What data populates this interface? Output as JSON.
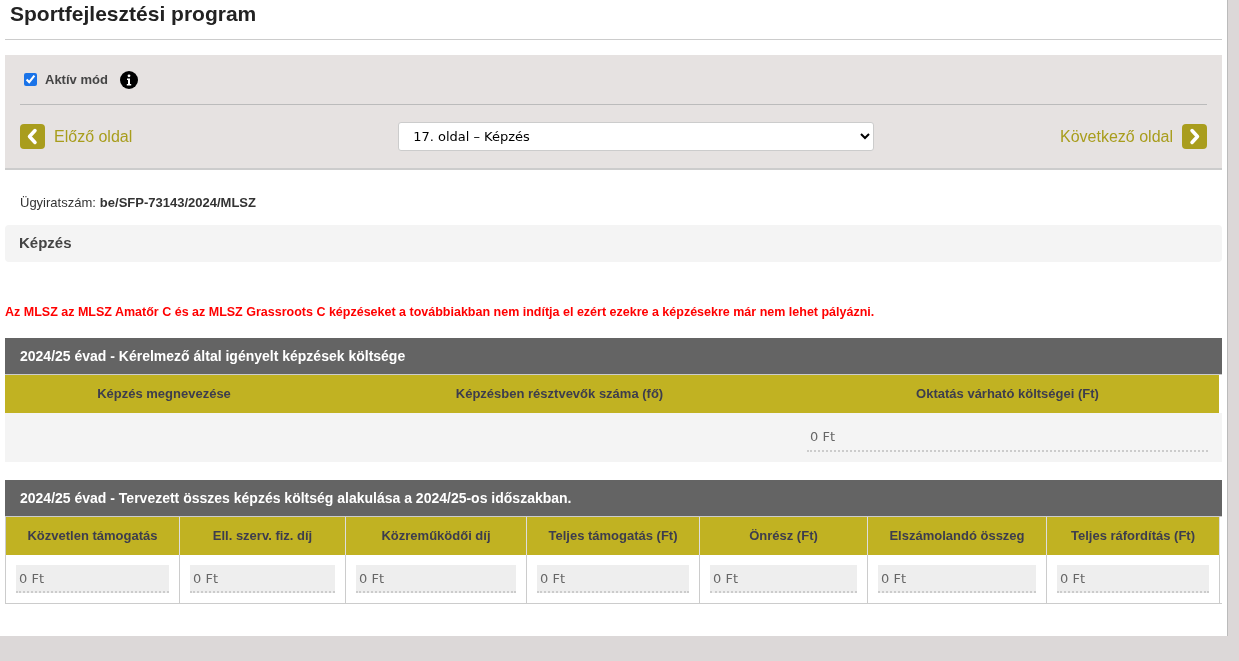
{
  "page_title": "Sportfejlesztési program",
  "toolbar": {
    "active_mode": {
      "label": "Aktív mód",
      "checked": true
    },
    "prev_label": "Előző oldal",
    "page_select": "17. oldal – Képzés",
    "next_label": "Következő oldal"
  },
  "case_number": {
    "label": "Ügyiratszám:",
    "value": "be/SFP-73143/2024/MLSZ"
  },
  "section_title": "Képzés",
  "notice": "Az MLSZ az MLSZ Amatőr C és az MLSZ Grassroots C képzéseket a továbbiakban nem indítja el ezért ezekre a képzésekre már nem lehet pályázni.",
  "table_1": {
    "title": "2024/25 évad - Kérelmező által igényelt képzések költsége",
    "columns": [
      "Képzés megnevezése",
      "Képzésben résztvevők száma (fő)",
      "Oktatás várható költségei (Ft)"
    ],
    "rows": [
      [
        "",
        "",
        "0 Ft"
      ]
    ]
  },
  "table_2": {
    "title": "2024/25 évad - Tervezett összes képzés költség alakulása a 2024/25-os időszakban.",
    "columns": [
      "Közvetlen támogatás",
      "Ell. szerv. fiz. díj",
      "Közreműködői díj",
      "Teljes támogatás (Ft)",
      "Önrész (Ft)",
      "Elszámolandó összeg",
      "Teljes ráfordítás (Ft)"
    ],
    "rows": [
      [
        "0 Ft",
        "0 Ft",
        "0 Ft",
        "0 Ft",
        "0 Ft",
        "0 Ft",
        "0 Ft"
      ]
    ]
  }
}
